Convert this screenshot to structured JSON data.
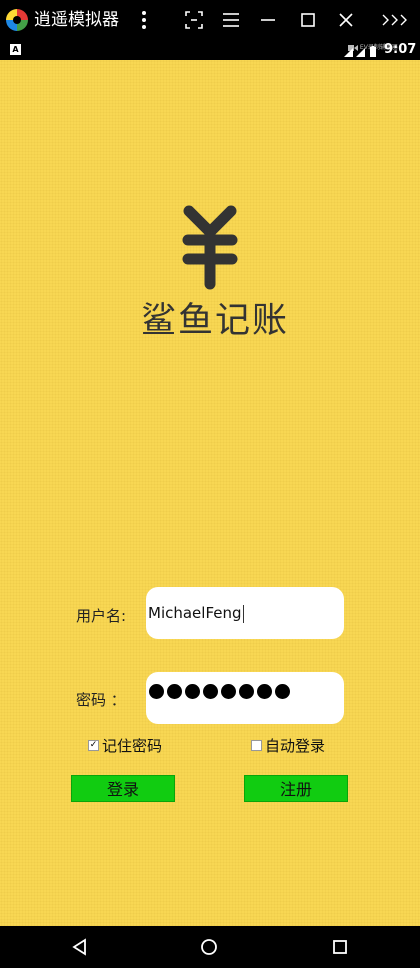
{
  "window": {
    "title": "逍遥模拟器"
  },
  "statusbar": {
    "time": "9:07",
    "ev_label": "EV录制辅助器",
    "notification_badge": "A"
  },
  "app": {
    "logo_symbol": "yen-icon",
    "logo_text": "鲨鱼记账",
    "username_label": "用户名:",
    "username_value": "MichaelFeng",
    "password_label": "密码 ：",
    "password_masked_length": 8,
    "remember_password_label": "记住密码",
    "remember_password_checked": true,
    "auto_login_label": "自动登录",
    "auto_login_checked": false,
    "login_button": "登录",
    "register_button": "注册",
    "colors": {
      "background": "#f8d753",
      "button": "#11cc11",
      "input": "#ffffff"
    }
  },
  "navbar": {
    "icons": [
      "back-icon",
      "home-icon",
      "recents-icon"
    ]
  }
}
